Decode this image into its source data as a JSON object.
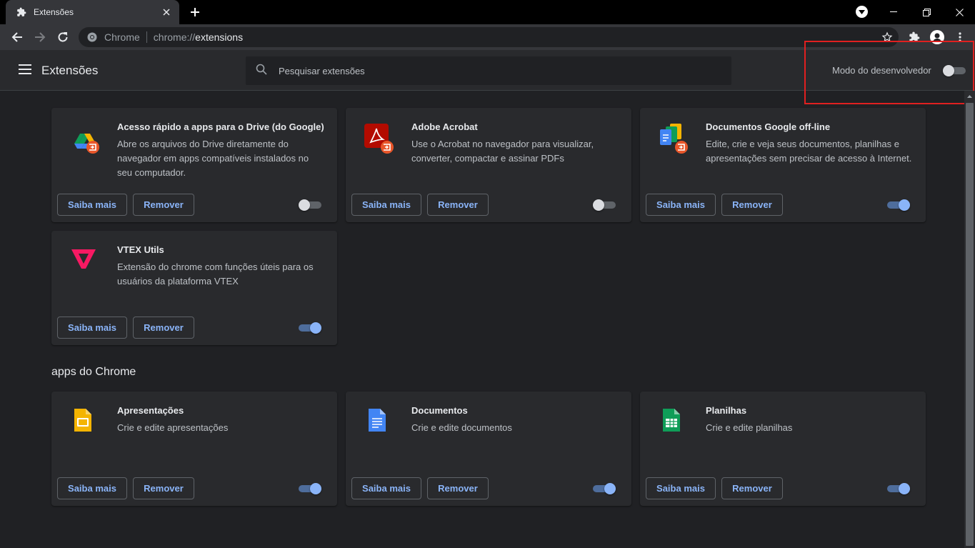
{
  "browser": {
    "tab_title": "Extensões",
    "omnibox_site": "Chrome",
    "omnibox_scheme": "chrome://",
    "omnibox_host": "extensions"
  },
  "header": {
    "title": "Extensões",
    "search_placeholder": "Pesquisar extensões",
    "devmode_label": "Modo do desenvolvedor",
    "devmode_enabled": false
  },
  "extensions": [
    {
      "name": "Acesso rápido a apps para o Drive (do Google)",
      "description": "Abre os arquivos do Drive diretamente do navegador em apps compatíveis instalados no seu computador.",
      "enabled": false,
      "icon": "google-drive-icon"
    },
    {
      "name": "Adobe Acrobat",
      "description": "Use o Acrobat no navegador para visualizar, converter, compactar e assinar PDFs",
      "enabled": false,
      "icon": "adobe-acrobat-icon"
    },
    {
      "name": "Documentos Google off-line",
      "description": "Edite, crie e veja seus documentos, planilhas e apresentações sem precisar de acesso à Internet.",
      "enabled": true,
      "icon": "google-docs-offline-icon"
    },
    {
      "name": "VTEX Utils",
      "description": "Extensão do chrome com funções úteis para os usuários da plataforma VTEX",
      "enabled": true,
      "icon": "vtex-icon"
    }
  ],
  "apps_section_title": "apps do Chrome",
  "apps": [
    {
      "name": "Apresentações",
      "description": "Crie e edite apresentações",
      "enabled": true,
      "icon": "google-slides-icon"
    },
    {
      "name": "Documentos",
      "description": "Crie e edite documentos",
      "enabled": true,
      "icon": "google-docs-icon"
    },
    {
      "name": "Planilhas",
      "description": "Crie e edite planilhas",
      "enabled": true,
      "icon": "google-sheets-icon"
    }
  ],
  "buttons": {
    "learn_more": "Saiba mais",
    "remove": "Remover"
  },
  "colors": {
    "accent": "#8ab4f8",
    "background": "#202124",
    "card": "#292a2d",
    "highlight_box": "#e02020"
  }
}
